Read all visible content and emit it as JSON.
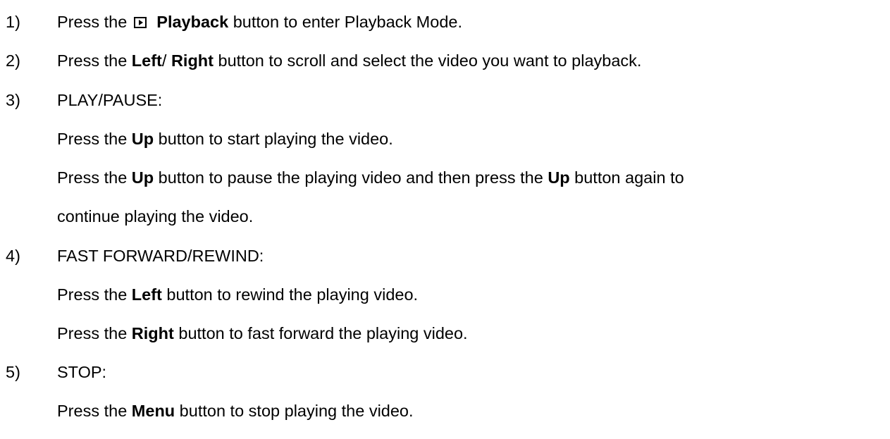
{
  "steps": [
    {
      "number": "1)",
      "parts": [
        "Press the",
        "Playback",
        " button to enter Playback Mode."
      ]
    },
    {
      "number": "2)",
      "parts": [
        "Press the ",
        "Left",
        "/ ",
        "Right",
        " button to scroll and select the video you want to playback."
      ]
    },
    {
      "number": "3)",
      "heading": "PLAY/PAUSE:",
      "lines": [
        [
          "Press the ",
          "Up",
          " button to start playing the video."
        ],
        [
          "Press the ",
          "Up",
          " button to pause the playing video and then press the ",
          "Up",
          " button again to"
        ],
        [
          "continue playing the video."
        ]
      ]
    },
    {
      "number": "4)",
      "heading": "FAST FORWARD/REWIND:",
      "lines": [
        [
          "Press the ",
          "Left",
          " button to rewind the playing video."
        ],
        [
          "Press the ",
          "Right",
          " button to fast forward the playing video."
        ]
      ]
    },
    {
      "number": "5)",
      "heading": "STOP:",
      "lines": [
        [
          "Press the ",
          "Menu",
          " button to stop playing the video."
        ]
      ]
    }
  ],
  "icons": {
    "playback": "playback-icon"
  }
}
